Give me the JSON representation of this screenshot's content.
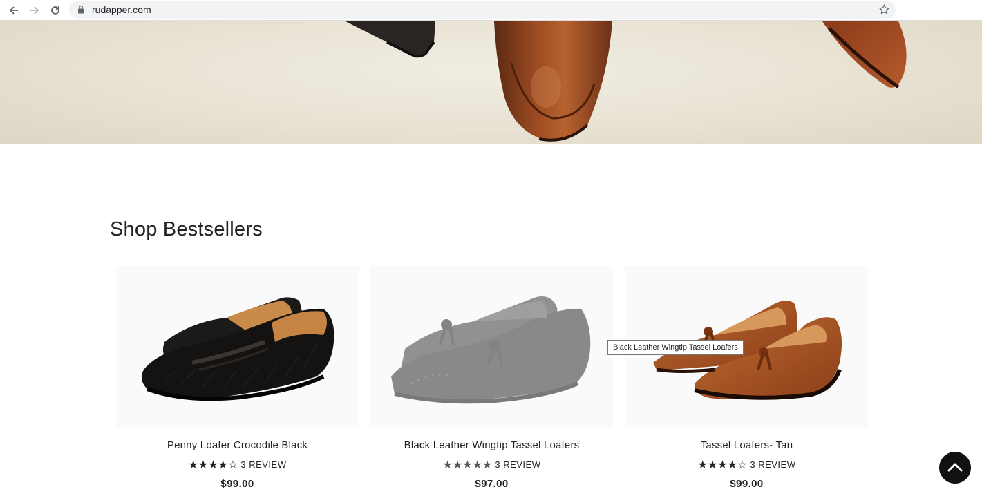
{
  "browser": {
    "url": "rudapper.com",
    "back_icon": "arrow-left-icon",
    "forward_icon": "arrow-right-icon",
    "reload_icon": "reload-icon",
    "bookmark_icon": "star-icon"
  },
  "section": {
    "title": "Shop Bestsellers"
  },
  "products": [
    {
      "name": "Penny Loafer Crocodile Black",
      "stars": "★★★★☆",
      "reviews": "3 REVIEW",
      "price": "$99.00",
      "rating": 4
    },
    {
      "name": "Black Leather Wingtip Tassel Loafers",
      "stars": "★★★★★",
      "reviews": "3 REVIEW",
      "price": "$97.00",
      "rating": 5
    },
    {
      "name": "Tassel Loafers- Tan",
      "stars": "★★★★☆",
      "reviews": "3 REVIEW",
      "price": "$99.00",
      "rating": 4
    }
  ],
  "tooltip": {
    "text": "Black Leather Wingtip Tassel Loafers"
  },
  "colors": {
    "accent": "#111111",
    "tan": "#a0522d",
    "black_shoe": "#1a1a1a",
    "gray_shoe": "#8c8c8c"
  }
}
